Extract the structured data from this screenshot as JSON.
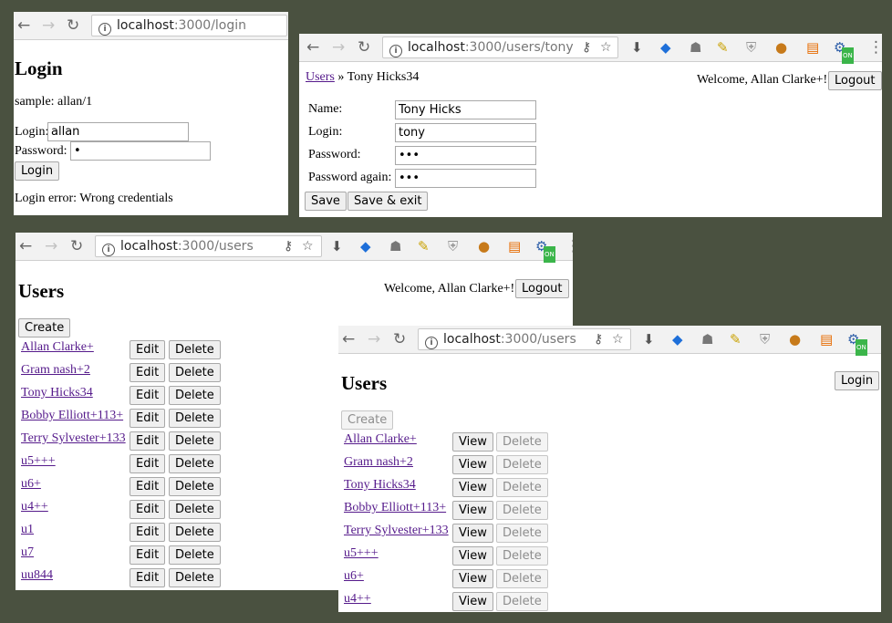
{
  "login_window": {
    "url_host": "localhost",
    "url_path": ":3000/login",
    "heading": "Login",
    "sample_text": "sample: allan/1",
    "login_label": "Login:",
    "login_value": "allan",
    "password_label": "Password:",
    "password_value": "•",
    "login_button": "Login",
    "error_text": "Login error: Wrong credentials"
  },
  "edit_window": {
    "url_host": "localhost",
    "url_path": ":3000/users/tony",
    "breadcrumb_link": "Users",
    "breadcrumb_rest": " » Tony Hicks34",
    "welcome": "Welcome, Allan Clarke+!",
    "logout_button": "Logout",
    "fields": [
      {
        "label": "Name:",
        "value": "Tony Hicks"
      },
      {
        "label": "Login:",
        "value": "tony"
      },
      {
        "label": "Password:",
        "value": "•••"
      },
      {
        "label": "Password again:",
        "value": "•••"
      }
    ],
    "save_button": "Save",
    "save_exit_button": "Save & exit"
  },
  "users_window": {
    "url_host": "localhost",
    "url_path": ":3000/users",
    "heading": "Users",
    "welcome": "Welcome, Allan Clarke+!",
    "logout_button": "Logout",
    "create_button": "Create",
    "edit_label": "Edit",
    "delete_label": "Delete",
    "users": [
      "Allan Clarke+",
      "Gram nash+2",
      "Tony Hicks34",
      "Bobby Elliott+113+",
      "Terry Sylvester+133",
      "u5+++",
      "u6+",
      "u4++",
      "u1",
      "u7",
      "uu844"
    ]
  },
  "guest_window": {
    "url_host": "localhost",
    "url_path": ":3000/users",
    "heading": "Users",
    "login_button": "Login",
    "create_button": "Create",
    "view_label": "View",
    "delete_label": "Delete",
    "users": [
      "Allan Clarke+",
      "Gram nash+2",
      "Tony Hicks34",
      "Bobby Elliott+113+",
      "Terry Sylvester+133",
      "u5+++",
      "u6+",
      "u4++"
    ]
  },
  "browser": {
    "back_icon": "←",
    "forward_icon": "→",
    "reload_icon": "↻",
    "info_icon": "i",
    "key_icon": "⚷",
    "star_icon": "☆",
    "download_icon": "⬇",
    "menu_icon": "⋮",
    "ext_on_badge": "ON"
  },
  "colors": {
    "desktop_bg": "#4a5140",
    "link_visited": "#551a8b",
    "toolbar_bg": "#f2f2f2"
  }
}
